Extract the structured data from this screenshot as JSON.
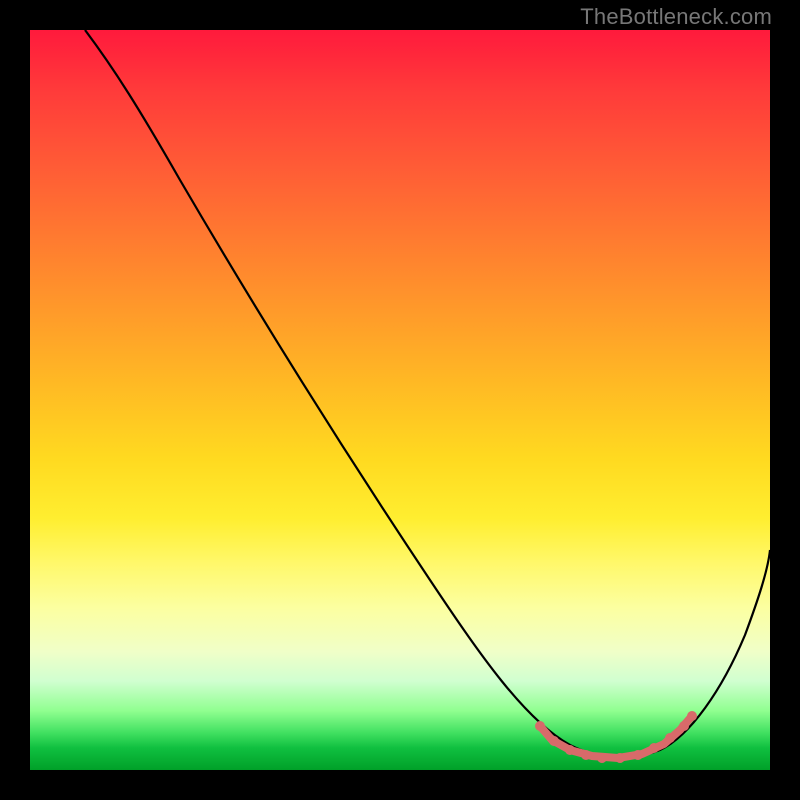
{
  "watermark": "TheBottleneck.com",
  "chart_data": {
    "type": "line",
    "title": "",
    "xlabel": "",
    "ylabel": "",
    "xlim": [
      0,
      100
    ],
    "ylim": [
      0,
      100
    ],
    "grid": false,
    "gradient_background": {
      "top": "#ff1a3c",
      "mid": "#ffda20",
      "bottom": "#00a028"
    },
    "series": [
      {
        "name": "curve",
        "x": [
          8,
          12,
          20,
          30,
          40,
          50,
          60,
          65,
          70,
          74,
          78,
          82,
          86,
          90,
          95,
          100
        ],
        "y": [
          100,
          96,
          86,
          72,
          58,
          44,
          30,
          22,
          13,
          7,
          3,
          2,
          3,
          8,
          17,
          30
        ]
      },
      {
        "name": "optimal-region",
        "x": [
          70,
          72,
          75,
          78,
          81,
          84,
          87,
          90
        ],
        "y": [
          12,
          8,
          5,
          3,
          2,
          2.5,
          4,
          8
        ]
      }
    ]
  }
}
